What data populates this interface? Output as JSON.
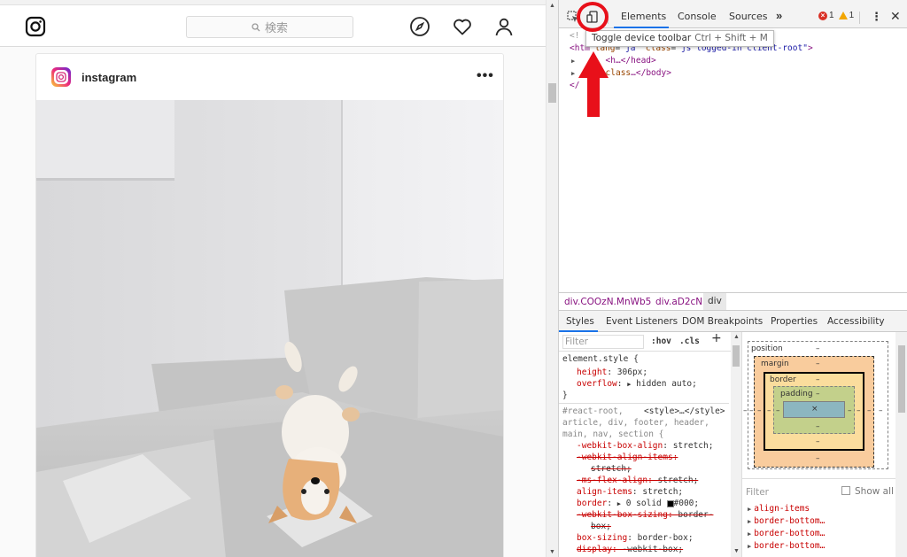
{
  "instagram": {
    "search_placeholder": "検索",
    "post": {
      "username": "instagram",
      "more": "•••"
    }
  },
  "devtools": {
    "tabs": [
      "Elements",
      "Console",
      "Sources"
    ],
    "more_tabs": "»",
    "error_count": "1",
    "warning_count": "1",
    "tooltip": {
      "label": "Toggle device toolbar",
      "shortcut": "Ctrl + Shift + M"
    },
    "dom": {
      "line1_tag": "<htm",
      "line1_attr_lang": "lang",
      "line1_lang": "\"ja\"",
      "line1_attr_class": "class",
      "line1_class": "\"js logged-in client-root\"",
      "line1_close": ">",
      "line2": "<h…</head>",
      "line3_attr": "class",
      "line3_rest": "…</body>",
      "line4": "</"
    },
    "breadcrumbs": [
      "div.COOzN.MnWb5",
      "div.aD2cN",
      "div"
    ],
    "subtabs": [
      "Styles",
      "Event Listeners",
      "DOM Breakpoints",
      "Properties",
      "Accessibility"
    ],
    "styles": {
      "filter_placeholder": "Filter",
      "hov": ":hov",
      "cls": ".cls",
      "add": "+",
      "element_style": "element.style {",
      "rule1_prop": "height",
      "rule1_val": "306px;",
      "rule2_prop": "overflow",
      "rule2_val": "hidden auto;",
      "close_brace": "}",
      "selector_line1": "#react-root,",
      "source": "<style>…</style>",
      "selector_line2": "article, div, footer, header,",
      "selector_line3": "main, nav, section {",
      "decl": [
        {
          "prop": "-webkit-box-align",
          "val": "stretch;",
          "struck": false
        },
        {
          "prop": "-webkit-align-items",
          "val": "",
          "struck": true
        },
        {
          "prop": "",
          "val": "stretch;",
          "struck": true
        },
        {
          "prop": "-ms-flex-align",
          "val": "stretch;",
          "struck": true
        },
        {
          "prop": "align-items",
          "val": "stretch;",
          "struck": false
        },
        {
          "prop": "border",
          "val": "0 solid #000;",
          "struck": false
        },
        {
          "prop": "-webkit-box-sizing",
          "val": "border-",
          "struck": true
        },
        {
          "prop": "",
          "val": "box;",
          "struck": true
        },
        {
          "prop": "box-sizing",
          "val": "border-box;",
          "struck": false
        },
        {
          "prop": "display",
          "val": "-webkit-box;",
          "struck": true
        }
      ]
    },
    "boxmodel": {
      "position": "position",
      "position_val": "–",
      "margin": "margin",
      "margin_val": "–",
      "border": "border",
      "border_val": "–",
      "padding": "padding",
      "padding_val": "–",
      "content": "×",
      "dash": "–"
    },
    "computed_filter": {
      "placeholder": "Filter",
      "show_all": "Show all"
    },
    "computed": [
      "align-items",
      "border-bottom…",
      "border-bottom…",
      "border-bottom…"
    ]
  }
}
